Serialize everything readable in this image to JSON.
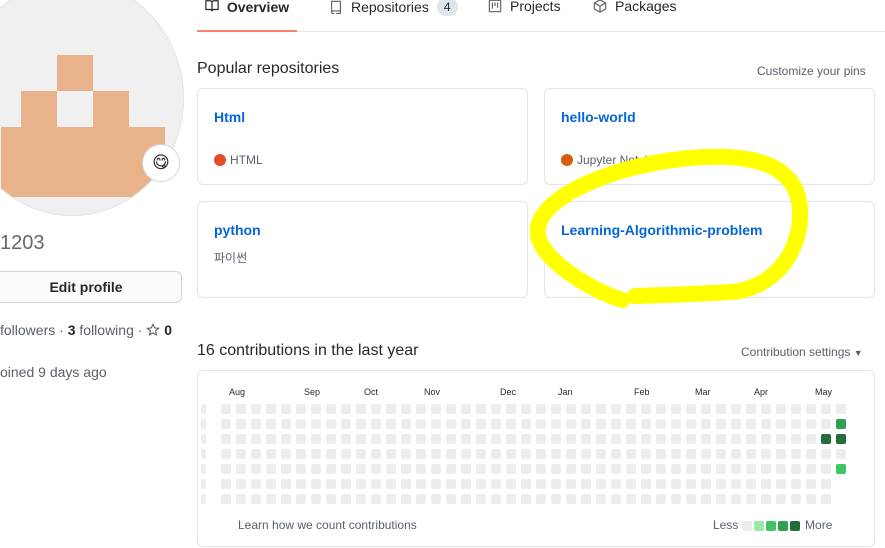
{
  "profile": {
    "username_fragment": "1203",
    "edit_profile_label": "Edit profile",
    "followers_label": "followers",
    "following_count": "3",
    "following_label": "following",
    "stars_count": "0",
    "joined_text": "oined 9 days ago",
    "status_emoji": "😋"
  },
  "tabs": [
    {
      "label": "Overview",
      "active": true
    },
    {
      "label": "Repositories",
      "count": "4"
    },
    {
      "label": "Projects"
    },
    {
      "label": "Packages"
    }
  ],
  "popular": {
    "title": "Popular repositories",
    "customize_label": "Customize your pins",
    "repos": [
      {
        "name": "Html",
        "description": "",
        "language": "HTML",
        "lang_color": "#e34c26"
      },
      {
        "name": "hello-world",
        "description": "",
        "language": "Jupyter Notebook",
        "lang_color": "#DA5B0B"
      },
      {
        "name": "python",
        "description": "파이썬",
        "language": ""
      },
      {
        "name": "Learning-Algorithmic-problem",
        "description": "",
        "language": ""
      }
    ]
  },
  "contributions": {
    "title": "16 contributions in the last year",
    "settings_label": "Contribution settings",
    "months": [
      "Aug",
      "Sep",
      "Oct",
      "Nov",
      "Dec",
      "Jan",
      "Feb",
      "Mar",
      "Apr",
      "May"
    ],
    "learn_label": "Learn how we count contributions",
    "less_label": "Less",
    "more_label": "More",
    "colors": {
      "empty": "#ebedf0",
      "l1": "#9be9a8",
      "l2": "#40c463",
      "l3": "#30a14e",
      "l4": "#216e39"
    },
    "active_cells": [
      {
        "week": 42,
        "day": 1,
        "level": "l3"
      },
      {
        "week": 41,
        "day": 2,
        "level": "l4"
      },
      {
        "week": 42,
        "day": 2,
        "level": "l4"
      },
      {
        "week": 42,
        "day": 4,
        "level": "l2"
      }
    ]
  },
  "annotation": {
    "color": "#ffff00"
  }
}
